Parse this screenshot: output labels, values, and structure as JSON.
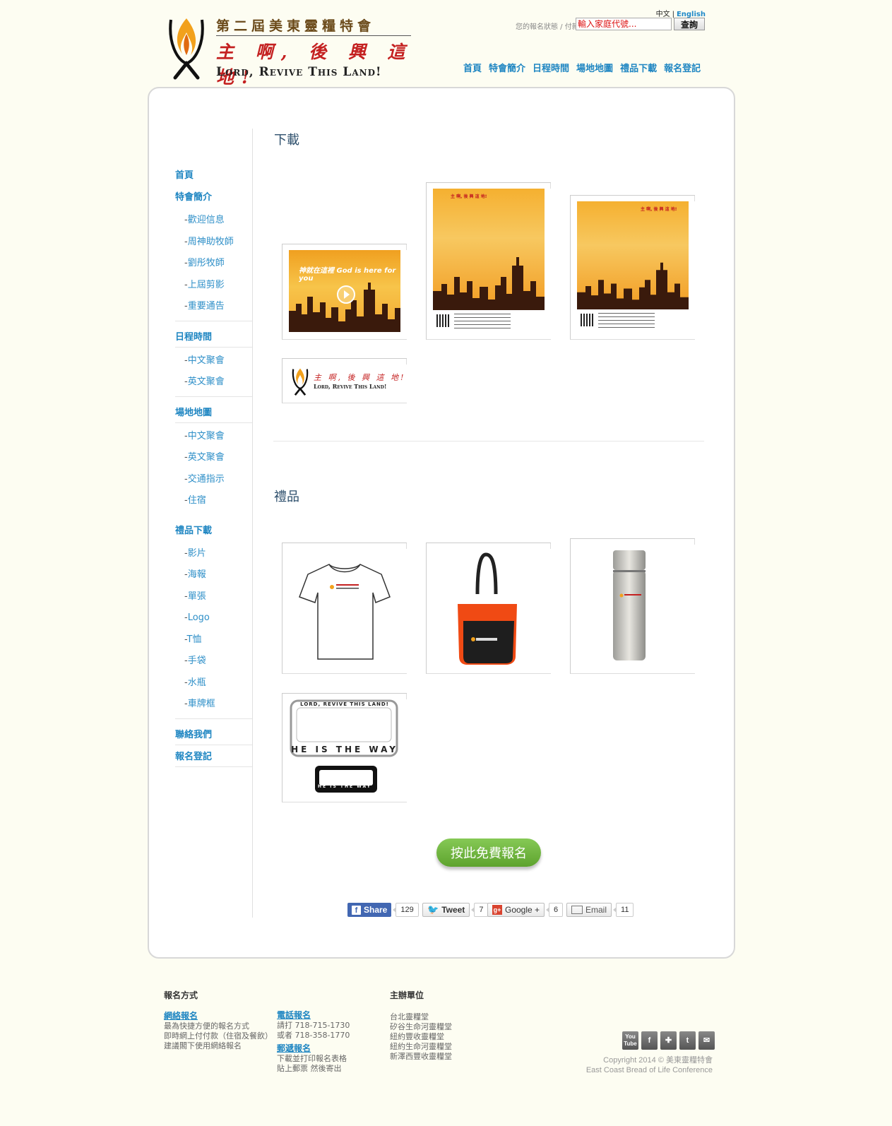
{
  "header": {
    "logo_title_cn": "第二屆美東靈糧特會",
    "logo_slogan_cn": "主 啊, 後 興 這 地!",
    "logo_slogan_en": "Lord, Revive This Land!",
    "lang_current": "中文",
    "lang_sep": "|",
    "lang_alt": "English",
    "reg_status_label": "您的報名狀態 / 付款:",
    "family_code_placeholder": "輸入家庭代號...",
    "query_button": "查詢",
    "nav": [
      "首頁",
      "特會簡介",
      "日程時間",
      "場地地圖",
      "禮品下載",
      "報名登記"
    ]
  },
  "sidebar": {
    "home": "首頁",
    "intro": {
      "label": "特會簡介",
      "items": [
        "歡迎信息",
        "周神助牧師",
        "劉彤牧師",
        "上屆剪影",
        "重要通告"
      ]
    },
    "schedule": {
      "label": "日程時間",
      "items": [
        "中文聚會",
        "英文聚會"
      ]
    },
    "venue": {
      "label": "場地地圖",
      "items": [
        "中文聚會",
        "英文聚會",
        "交通指示",
        "住宿"
      ]
    },
    "downloads": {
      "label": "禮品下載",
      "items": [
        "影片",
        "海報",
        "單張",
        "Logo",
        "T恤",
        "手袋",
        "水瓶",
        "車牌框"
      ]
    },
    "contact": "聯絡我們",
    "register": "報名登記",
    "dash": "-"
  },
  "main": {
    "downloads_title": "下載",
    "gifts_title": "禮品",
    "video_caption": "神就在這裡 God is here for you",
    "plate_top": "LORD, REVIVE THIS LAND!",
    "plate_bottom": "HE IS THE WAY",
    "cta": "按此免費報名"
  },
  "share": {
    "facebook": {
      "label": "Share",
      "count": "129"
    },
    "twitter": {
      "label": "Tweet",
      "count": "7"
    },
    "google": {
      "label": "Google +",
      "count": "6"
    },
    "email": {
      "label": "Email",
      "count": "11"
    }
  },
  "footer": {
    "col1_title": "報名方式",
    "online_link": "網絡報名",
    "online_lines": [
      "最為快捷方便的報名方式",
      "即時網上付付款（住宿及餐飲）",
      "建議閣下使用網絡報名"
    ],
    "phone_link": "電話報名",
    "phone_lines": [
      "請打 718-715-1730",
      "或者 718-358-1770"
    ],
    "mail_link": "郵遞報名",
    "mail_lines": [
      "下載並打印報名表格",
      "貼上郵票 然後寄出"
    ],
    "col3_title": "主辦單位",
    "hosts": [
      "台北靈糧堂",
      "矽谷生命河靈糧堂",
      "紐約豐收靈糧堂",
      "紐約生命河靈糧堂",
      "新澤西豐收靈糧堂"
    ],
    "social": [
      "You Tube",
      "f",
      "✚",
      "t",
      "✉"
    ],
    "copyright": "Copyright 2014 © 美東靈糧特會",
    "org_en": "East Coast Bread of Life Conference"
  },
  "colors": {
    "link": "#1f86c2",
    "cta": "#6bb33a",
    "panel_border": "#d8d8d8",
    "page_bg": "#fdfdf2"
  }
}
